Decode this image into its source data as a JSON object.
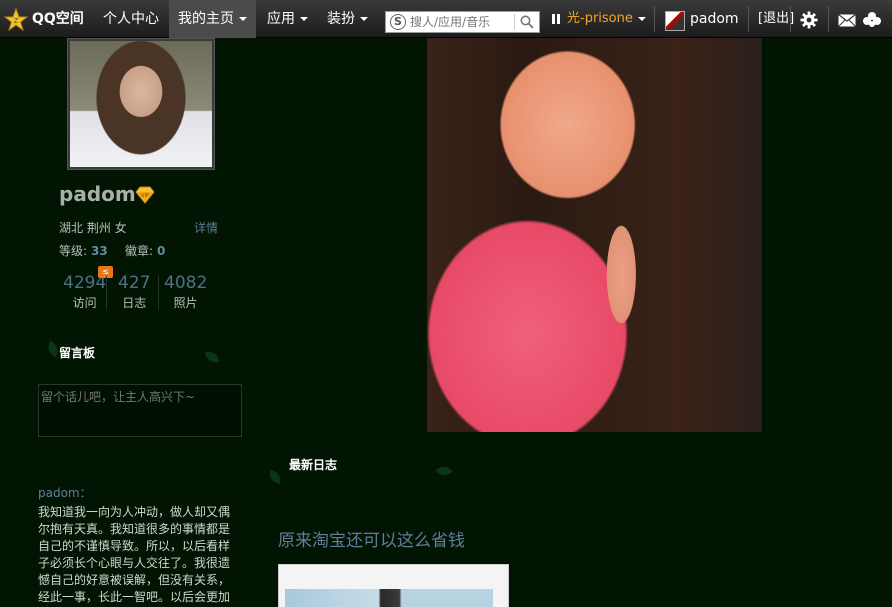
{
  "topbar": {
    "brand": "QQ空间",
    "nav": [
      {
        "label": "个人中心",
        "has_menu": false
      },
      {
        "label": "我的主页",
        "has_menu": true,
        "active": true
      },
      {
        "label": "应用",
        "has_menu": true
      },
      {
        "label": "装扮",
        "has_menu": true
      }
    ],
    "search_placeholder": "搜人/应用/音乐",
    "music_title": "光-prisone",
    "username": "padom",
    "logout": "[退出]",
    "icons": [
      "qzone-star-icon",
      "search-icon",
      "pause-icon",
      "settings-gear-icon",
      "mail-icon",
      "clover-icon"
    ]
  },
  "profile": {
    "name": "padom",
    "location": "湖北 荆州 女",
    "detail_link": "详情",
    "level_label": "等级:",
    "level_value": "33",
    "badge_label": "徽章:",
    "badge_value": "0",
    "stats": [
      {
        "value": "4294",
        "label": "访问"
      },
      {
        "value": "427",
        "label": "日志"
      },
      {
        "value": "4082",
        "label": "照片"
      }
    ]
  },
  "guestbook": {
    "title": "留言板",
    "placeholder": "留个话儿吧，让主人高兴下~"
  },
  "latest_note": {
    "author": "padom：",
    "text": "我知道我一向为人冲动，做人却又偶尔抱有天真。我知道很多的事情都是自己的不谨慎导致。所以，以后看样子必须长个心眼与人交往了。我很遗憾自己的好意被误解，但没有关系，经此一事，长此一智吧。以后会更加"
  },
  "main": {
    "section_title": "最新日志",
    "post_title": "原来淘宝还可以这么省钱"
  },
  "colors": {
    "background": "#021402",
    "link": "#5f7e9a",
    "music": "#f5a623",
    "badge": "#e8751a"
  }
}
